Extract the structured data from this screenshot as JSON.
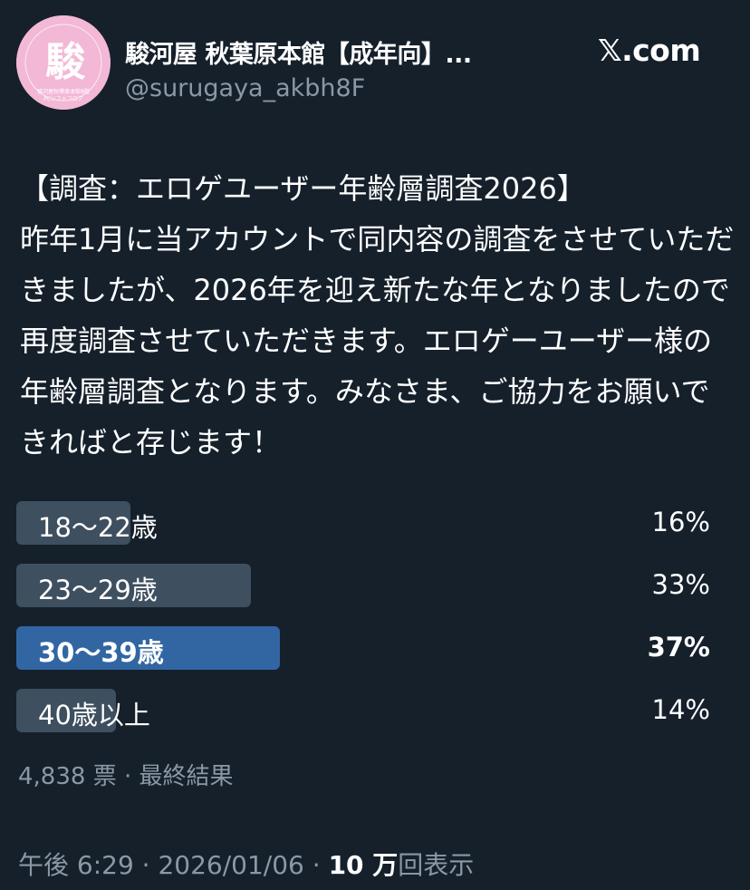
{
  "header": {
    "display_name": "駿河屋 秋葉原本館【成年向】...",
    "handle": "@surugaya_akbh8F",
    "brand": "𝕏.com",
    "avatar": {
      "logo_char": "駿",
      "caption_line1": "駿河屋秋葉原本館8階",
      "caption_line2": "PCソフトフロア",
      "colors": {
        "background": "#f3b8d6",
        "ink": "#ffffff"
      }
    }
  },
  "tweet": {
    "text": "【調査：エロゲユーザー年齢層調査2026】\n昨年1月に当アカウントで同内容の調査をさせていただきましたが、2026年を迎え新たな年となりましたので再度調査させていただきます。エロゲーユーザー様の年齢層調査となります。みなさま、ご協力をお願いできればと存じます！"
  },
  "poll": {
    "options": [
      {
        "label": "18～22歳",
        "percent_text": "16%",
        "fill_fraction": 0.16,
        "winner": false
      },
      {
        "label": "23～29歳",
        "percent_text": "33%",
        "fill_fraction": 0.33,
        "winner": false
      },
      {
        "label": "30～39歳",
        "percent_text": "37%",
        "fill_fraction": 0.37,
        "winner": true
      },
      {
        "label": "40歳以上",
        "percent_text": "14%",
        "fill_fraction": 0.14,
        "winner": false
      }
    ],
    "votes": "4,838 票",
    "separator": " · ",
    "status": "最終結果"
  },
  "footer": {
    "time": "午後 6:29",
    "date": "2026/01/06",
    "separator": " · ",
    "views_count": "10 万",
    "views_label": "回表示"
  },
  "colors": {
    "background": "#15202b",
    "text": "#ffffff",
    "muted": "#8b98a5",
    "poll_bar": "#3e4f5f",
    "poll_bar_winner": "#3166a3"
  }
}
